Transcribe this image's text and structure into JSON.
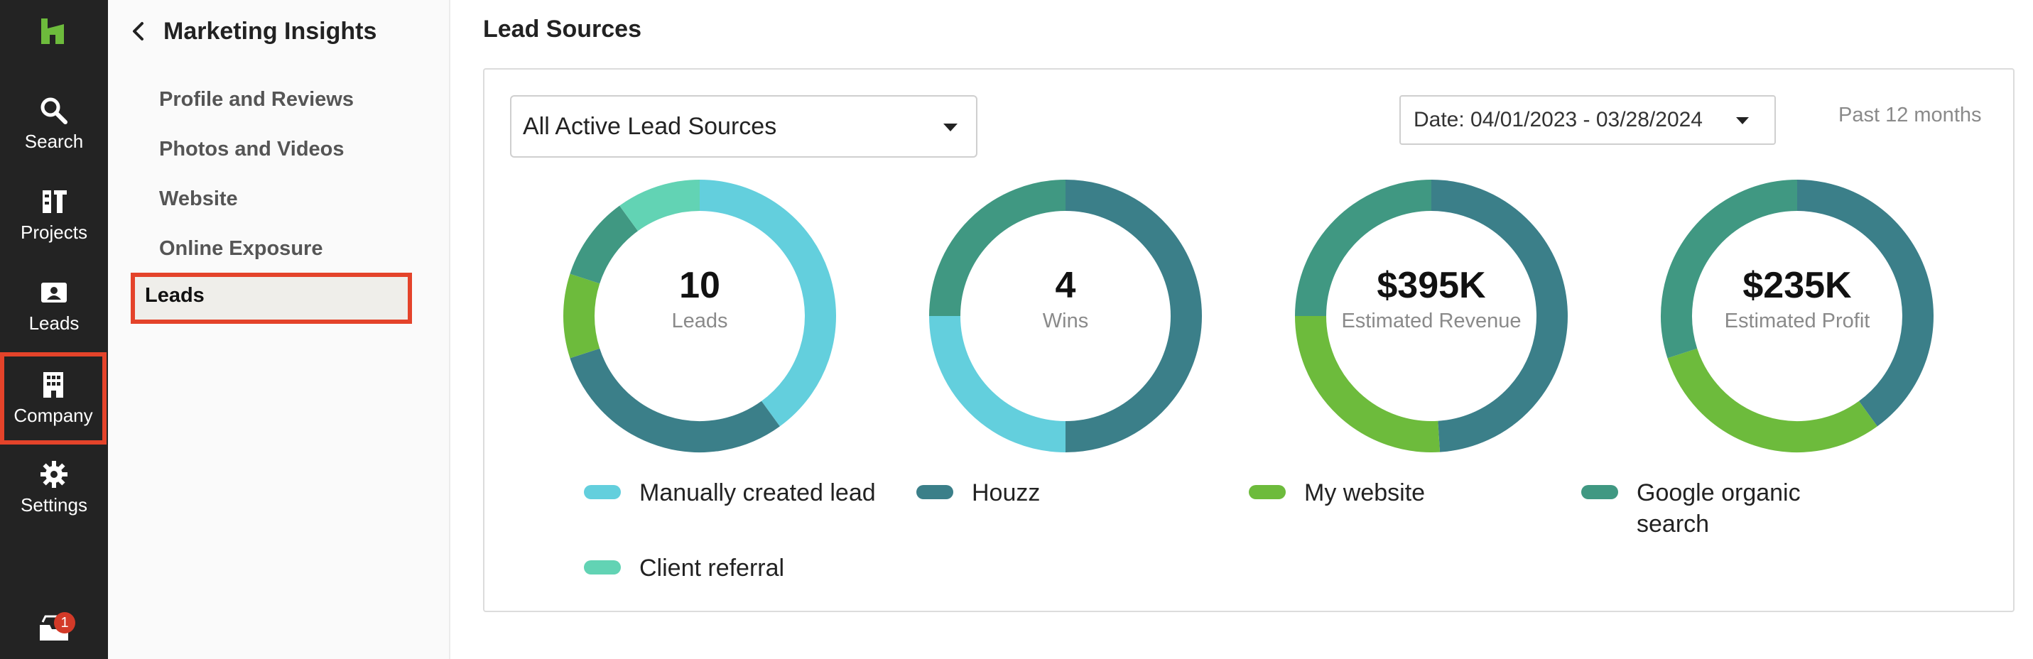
{
  "rail": {
    "items": [
      {
        "label": "Search",
        "icon": "search-icon"
      },
      {
        "label": "Projects",
        "icon": "projects-icon"
      },
      {
        "label": "Leads",
        "icon": "leads-icon"
      },
      {
        "label": "Company",
        "icon": "company-icon",
        "selected": true
      },
      {
        "label": "Settings",
        "icon": "gear-icon"
      }
    ],
    "inbox_badge": "1"
  },
  "subnav": {
    "title": "Marketing Insights",
    "items": [
      {
        "label": "Profile and Reviews"
      },
      {
        "label": "Photos and Videos"
      },
      {
        "label": "Website"
      },
      {
        "label": "Online Exposure"
      },
      {
        "label": "Leads",
        "active": true
      }
    ]
  },
  "main": {
    "title": "Lead Sources",
    "source_select": "All Active Lead Sources",
    "date_range": "Date: 04/01/2023 - 03/28/2024",
    "period": "Past 12 months"
  },
  "colors": {
    "manual": "#63cfdd",
    "houzz": "#3b7f89",
    "website": "#6dbb3c",
    "google": "#409882",
    "referral": "#62d3b4",
    "accent_highlight": "#e4432a"
  },
  "chart_data": [
    {
      "type": "pie",
      "value_label": "10",
      "caption": "Leads",
      "slices": [
        {
          "source": "Manually created lead",
          "value": 4
        },
        {
          "source": "Houzz",
          "value": 3
        },
        {
          "source": "My website",
          "value": 1
        },
        {
          "source": "Google organic search",
          "value": 1
        },
        {
          "source": "Client referral",
          "value": 1
        }
      ]
    },
    {
      "type": "pie",
      "value_label": "4",
      "caption": "Wins",
      "slices": [
        {
          "source": "Houzz",
          "value": 2
        },
        {
          "source": "Manually created lead",
          "value": 1
        },
        {
          "source": "Google organic search",
          "value": 1
        }
      ]
    },
    {
      "type": "pie",
      "value_label": "$395K",
      "caption": "Estimated Revenue",
      "slices": [
        {
          "source": "Houzz",
          "value": 0.49
        },
        {
          "source": "My website",
          "value": 0.26
        },
        {
          "source": "Google organic search",
          "value": 0.25
        }
      ]
    },
    {
      "type": "pie",
      "value_label": "$235K",
      "caption": "Estimated Profit",
      "slices": [
        {
          "source": "Houzz",
          "value": 0.4
        },
        {
          "source": "My website",
          "value": 0.3
        },
        {
          "source": "Google organic search",
          "value": 0.3
        }
      ]
    }
  ],
  "legend": [
    {
      "label": "Manually created lead",
      "color": "#63cfdd"
    },
    {
      "label": "Houzz",
      "color": "#3b7f89"
    },
    {
      "label": "My website",
      "color": "#6dbb3c"
    },
    {
      "label": "Google organic search",
      "color": "#409882"
    },
    {
      "label": "Client referral",
      "color": "#62d3b4"
    }
  ]
}
